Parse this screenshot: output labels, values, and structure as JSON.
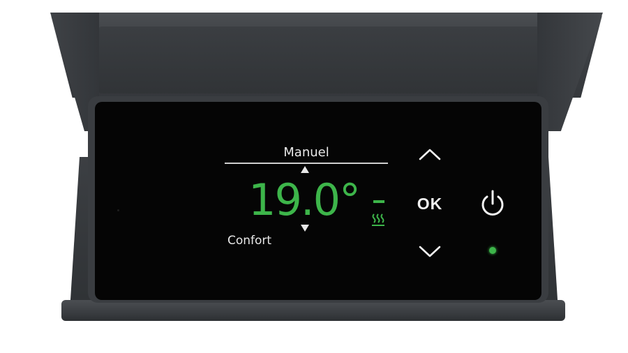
{
  "display": {
    "mode": "Manuel",
    "temperature": "19.0°",
    "preset": "Confort",
    "setpoint_indicator": "-"
  },
  "controls": {
    "ok_label": "OK",
    "up_icon": "chevron-up-icon",
    "down_icon": "chevron-down-icon",
    "power_icon": "power-icon",
    "heat_icon": "heat-waves-icon"
  },
  "status": {
    "power_led": "on"
  },
  "colors": {
    "accent": "#3db54a",
    "screen": "#050505",
    "housing": "#3a3d41",
    "text": "#e8e8e8"
  }
}
